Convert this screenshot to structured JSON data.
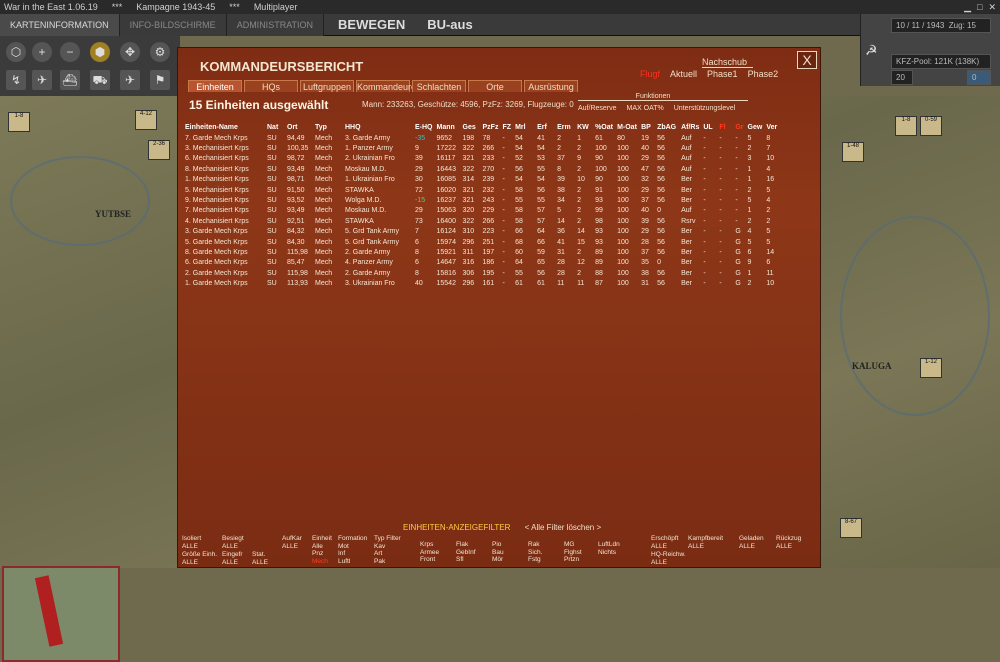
{
  "window": {
    "title": "War in the East 1.06.19",
    "campaign": "Kampagne 1943-45",
    "mode": "Multiplayer",
    "sep": "***"
  },
  "menu": {
    "tabs": [
      "KARTENINFORMATION",
      "INFO-BILDSCHIRME",
      "ADMINISTRATION"
    ],
    "mode1": "BEWEGEN",
    "mode2": "BU-aus"
  },
  "status": {
    "date": "10 / 11 / 1943",
    "turn": "Zug: 15",
    "kfz": "KFZ-Pool: 121K (138K)",
    "val1": "20",
    "val2": "0"
  },
  "map": {
    "cities": [
      "YUTBSE",
      "KALUGA"
    ],
    "counters": [
      "1-8",
      "0-59",
      "1-8",
      "1-12",
      "2-36",
      "4-12",
      "1-48",
      "8-67"
    ]
  },
  "report": {
    "title": "KOMMANDEURSBERICHT",
    "close": "X",
    "tabs": [
      "Einheiten",
      "HQs",
      "Luftgruppen",
      "Kommandeure",
      "Schlachten",
      "Orte",
      "Ausrüstung"
    ],
    "supply": {
      "label": "Nachschub",
      "selected": "Flugf",
      "options": [
        "Aktuell",
        "Phase1",
        "Phase2"
      ]
    },
    "selection": "15 Einheiten ausgewählt",
    "stats": "Mann: 233263, Geschütze: 4596, PzFz: 3269, Flugzeuge: 0",
    "functions": {
      "label": "Funktionen",
      "items": [
        "Auf/Reserve",
        "MAX OAT%",
        "Unterstützungslevel"
      ]
    },
    "columns": [
      "Einheiten-Name",
      "Nat",
      "Ort",
      "Typ",
      "HHQ",
      "E-HQ",
      "Mann",
      "Ges",
      "PzFz",
      "FZ",
      "Mrl",
      "Erf",
      "Erm",
      "KW",
      "%Oat",
      "M-Oat",
      "BP",
      "ZbAG",
      "Af/Rs",
      "UL",
      "Fl",
      "Gr",
      "Gew",
      "Ver"
    ],
    "rows": [
      [
        "7. Garde Mech Krps",
        "SU",
        "94,49",
        "Mech",
        "3. Garde Army",
        "-35",
        "9652",
        "198",
        "78",
        "-",
        "54",
        "41",
        "2",
        "1",
        "61",
        "80",
        "19",
        "56",
        "Auf",
        "-",
        "-",
        "-",
        "5",
        "8"
      ],
      [
        "3. Mechanisiert Krps",
        "SU",
        "100,35",
        "Mech",
        "1. Panzer Army",
        "9",
        "17222",
        "322",
        "266",
        "-",
        "54",
        "54",
        "2",
        "2",
        "100",
        "100",
        "40",
        "56",
        "Auf",
        "-",
        "-",
        "-",
        "2",
        "7"
      ],
      [
        "6. Mechanisiert Krps",
        "SU",
        "98,72",
        "Mech",
        "2. Ukrainian Fro",
        "39",
        "16117",
        "321",
        "233",
        "-",
        "52",
        "53",
        "37",
        "9",
        "90",
        "100",
        "29",
        "56",
        "Auf",
        "-",
        "-",
        "-",
        "3",
        "10"
      ],
      [
        "8. Mechanisiert Krps",
        "SU",
        "93,49",
        "Mech",
        "Moskau M.D.",
        "29",
        "16443",
        "322",
        "270",
        "-",
        "56",
        "55",
        "8",
        "2",
        "100",
        "100",
        "47",
        "56",
        "Auf",
        "-",
        "-",
        "-",
        "1",
        "4"
      ],
      [
        "1. Mechanisiert Krps",
        "SU",
        "98,71",
        "Mech",
        "1. Ukrainian Fro",
        "30",
        "16085",
        "314",
        "239",
        "-",
        "54",
        "54",
        "39",
        "10",
        "90",
        "100",
        "32",
        "56",
        "Ber",
        "-",
        "-",
        "-",
        "1",
        "16"
      ],
      [
        "5. Mechanisiert Krps",
        "SU",
        "91,50",
        "Mech",
        "STAWKA",
        "72",
        "16020",
        "321",
        "232",
        "-",
        "58",
        "56",
        "38",
        "2",
        "91",
        "100",
        "29",
        "56",
        "Ber",
        "-",
        "-",
        "-",
        "2",
        "5"
      ],
      [
        "9. Mechanisiert Krps",
        "SU",
        "93,52",
        "Mech",
        "Wolga M.D.",
        "-15",
        "16237",
        "321",
        "243",
        "-",
        "55",
        "55",
        "34",
        "2",
        "93",
        "100",
        "37",
        "56",
        "Ber",
        "-",
        "-",
        "-",
        "5",
        "4"
      ],
      [
        "7. Mechanisiert Krps",
        "SU",
        "93,49",
        "Mech",
        "Moskau M.D.",
        "29",
        "15063",
        "320",
        "229",
        "-",
        "58",
        "57",
        "5",
        "2",
        "99",
        "100",
        "40",
        "0",
        "Auf",
        "-",
        "-",
        "-",
        "1",
        "2"
      ],
      [
        "4. Mechanisiert Krps",
        "SU",
        "92,51",
        "Mech",
        "STAWKA",
        "73",
        "16400",
        "322",
        "266",
        "-",
        "58",
        "57",
        "14",
        "2",
        "98",
        "100",
        "39",
        "56",
        "Rsrv",
        "-",
        "-",
        "-",
        "2",
        "2"
      ],
      [
        "3. Garde Mech Krps",
        "SU",
        "84,32",
        "Mech",
        "5. Grd Tank Army",
        "7",
        "16124",
        "310",
        "223",
        "-",
        "66",
        "64",
        "36",
        "14",
        "93",
        "100",
        "29",
        "56",
        "Ber",
        "-",
        "-",
        "G",
        "4",
        "5"
      ],
      [
        "5. Garde Mech Krps",
        "SU",
        "84,30",
        "Mech",
        "5. Grd Tank Army",
        "6",
        "15974",
        "296",
        "251",
        "-",
        "68",
        "66",
        "41",
        "15",
        "93",
        "100",
        "28",
        "56",
        "Ber",
        "-",
        "-",
        "G",
        "5",
        "5"
      ],
      [
        "8. Garde Mech Krps",
        "SU",
        "115,98",
        "Mech",
        "2. Garde Army",
        "8",
        "15921",
        "311",
        "197",
        "-",
        "60",
        "59",
        "31",
        "2",
        "89",
        "100",
        "37",
        "56",
        "Ber",
        "-",
        "-",
        "G",
        "6",
        "14"
      ],
      [
        "6. Garde Mech Krps",
        "SU",
        "85,47",
        "Mech",
        "4. Panzer Army",
        "6",
        "14647",
        "316",
        "186",
        "-",
        "64",
        "65",
        "28",
        "12",
        "89",
        "100",
        "35",
        "0",
        "Ber",
        "-",
        "-",
        "G",
        "9",
        "6"
      ],
      [
        "2. Garde Mech Krps",
        "SU",
        "115,98",
        "Mech",
        "2. Garde Army",
        "8",
        "15816",
        "306",
        "195",
        "-",
        "55",
        "56",
        "28",
        "2",
        "88",
        "100",
        "38",
        "56",
        "Ber",
        "-",
        "-",
        "G",
        "1",
        "11"
      ],
      [
        "1. Garde Mech Krps",
        "SU",
        "113,93",
        "Mech",
        "3. Ukrainian Fro",
        "40",
        "15542",
        "296",
        "161",
        "-",
        "61",
        "61",
        "11",
        "11",
        "87",
        "100",
        "31",
        "56",
        "Ber",
        "-",
        "-",
        "G",
        "2",
        "10"
      ]
    ]
  },
  "filters": {
    "title": "EINHEITEN-ANZEIGEFILTER",
    "clear": "< Alle Filter löschen >",
    "items": [
      {
        "t": "Isoliert\nALLE"
      },
      {
        "t": "Besiegt\nALLE"
      },
      {
        "t": "AufKar\nALLE"
      },
      {
        "t": "Einheit\nAlle\nPnz\n",
        "sel": "Mech"
      },
      {
        "t": "Formation\nMot\nInf\nLuftl"
      },
      {
        "t": "Typ Filter\nKav\nArt\nPak"
      },
      {
        "t": "Krps\nArmee\nFront"
      },
      {
        "t": "Flak\nGebInf\nSfl"
      },
      {
        "t": "Pio\nBau\nMör"
      },
      {
        "t": "Rak\nSich.\nFstg"
      },
      {
        "t": "MG\nFlghst\nPrtzn"
      },
      {
        "t": "LuftLdn\nNichts"
      },
      {
        "t": "Erschöpft\nALLE"
      },
      {
        "t": "Kampfbereit\nALLE"
      },
      {
        "t": "Geladen\nALLE"
      },
      {
        "t": "Rückzug\nALLE"
      },
      {
        "t": "Größe Einh.\nALLE"
      },
      {
        "t": "Eingefr\nALLE"
      },
      {
        "t": "Stat.\nALLE"
      },
      {
        "t": "HQ-Reichw.\nALLE"
      }
    ]
  }
}
